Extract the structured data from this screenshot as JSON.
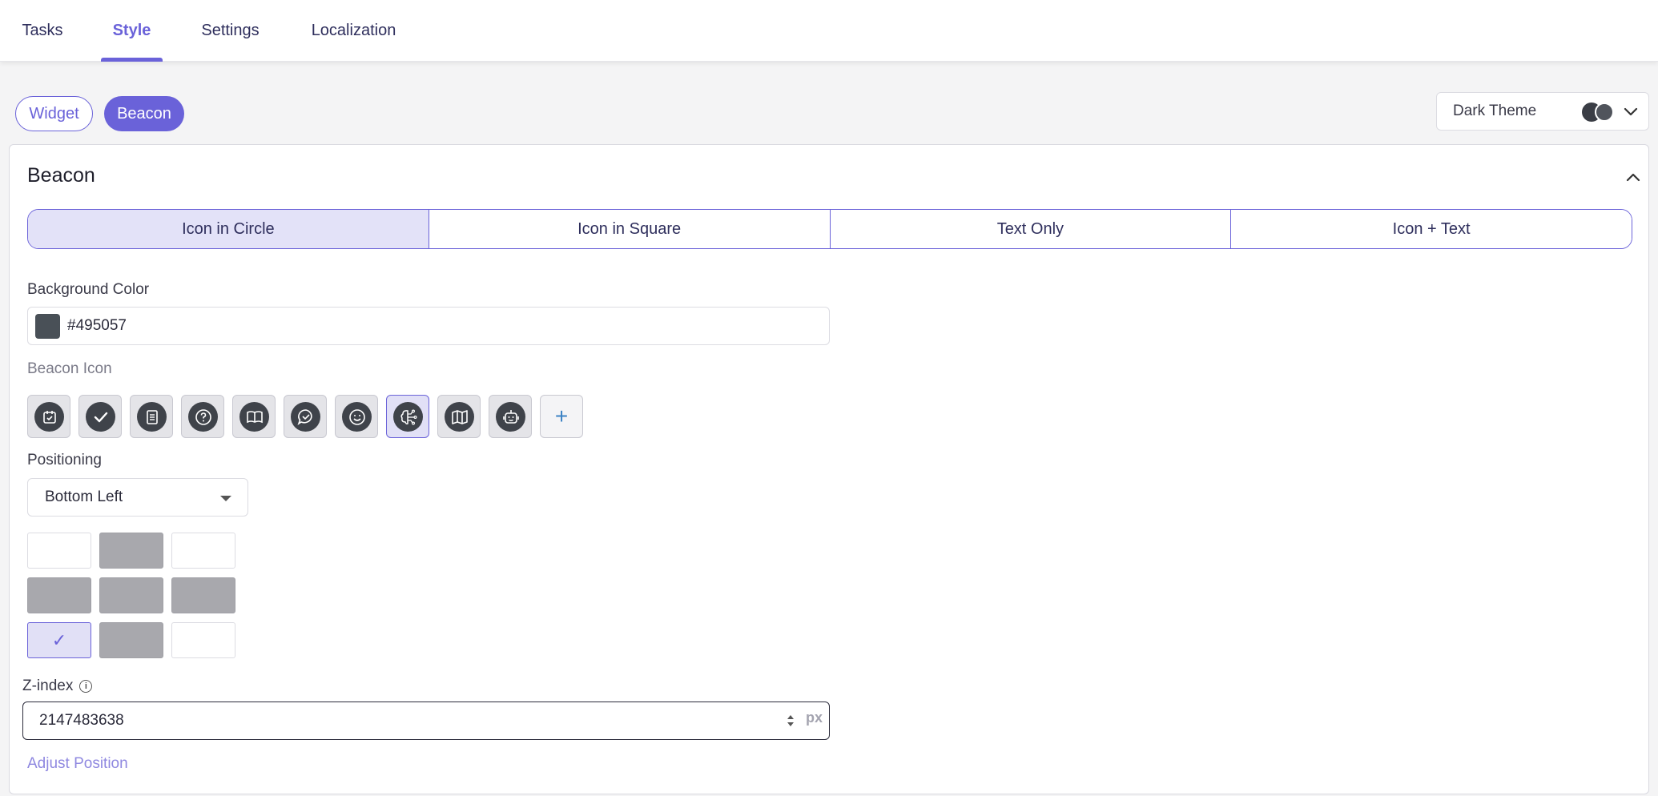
{
  "nav": {
    "tabs": [
      {
        "label": "Tasks"
      },
      {
        "label": "Style"
      },
      {
        "label": "Settings"
      },
      {
        "label": "Localization"
      }
    ],
    "active_tab": "Style"
  },
  "subtabs": {
    "widget": "Widget",
    "beacon": "Beacon",
    "active": "Beacon"
  },
  "theme": {
    "label": "Dark Theme",
    "dot_colors": [
      "#3a3d45",
      "#50545c"
    ]
  },
  "card": {
    "title": "Beacon",
    "styles": [
      {
        "label": "Icon in Circle"
      },
      {
        "label": "Icon in Square"
      },
      {
        "label": "Text Only"
      },
      {
        "label": "Icon + Text"
      }
    ],
    "active_style": "Icon in Circle",
    "background_color": {
      "label": "Background Color",
      "value": "#495057",
      "swatch": "#495057"
    },
    "beacon_icon": {
      "label": "Beacon Icon",
      "icons": [
        "calendar-check-icon",
        "check-icon",
        "document-icon",
        "question-icon",
        "book-icon",
        "chat-check-icon",
        "smiley-icon",
        "brain-circuit-icon",
        "map-icon",
        "robot-icon"
      ],
      "selected": "brain-circuit-icon",
      "add_label": "+"
    },
    "positioning": {
      "label": "Positioning",
      "value": "Bottom Left",
      "grid": [
        [
          "empty",
          "filled",
          "empty"
        ],
        [
          "filled",
          "filled",
          "filled"
        ],
        [
          "checked",
          "filled",
          "empty"
        ]
      ],
      "check_glyph": "✓"
    },
    "zindex": {
      "label": "Z-index",
      "value": "2147483638",
      "unit": "px"
    },
    "adjust_label": "Adjust Position"
  },
  "colors": {
    "accent": "#6a62d9",
    "icon_dark": "#3f434a"
  }
}
